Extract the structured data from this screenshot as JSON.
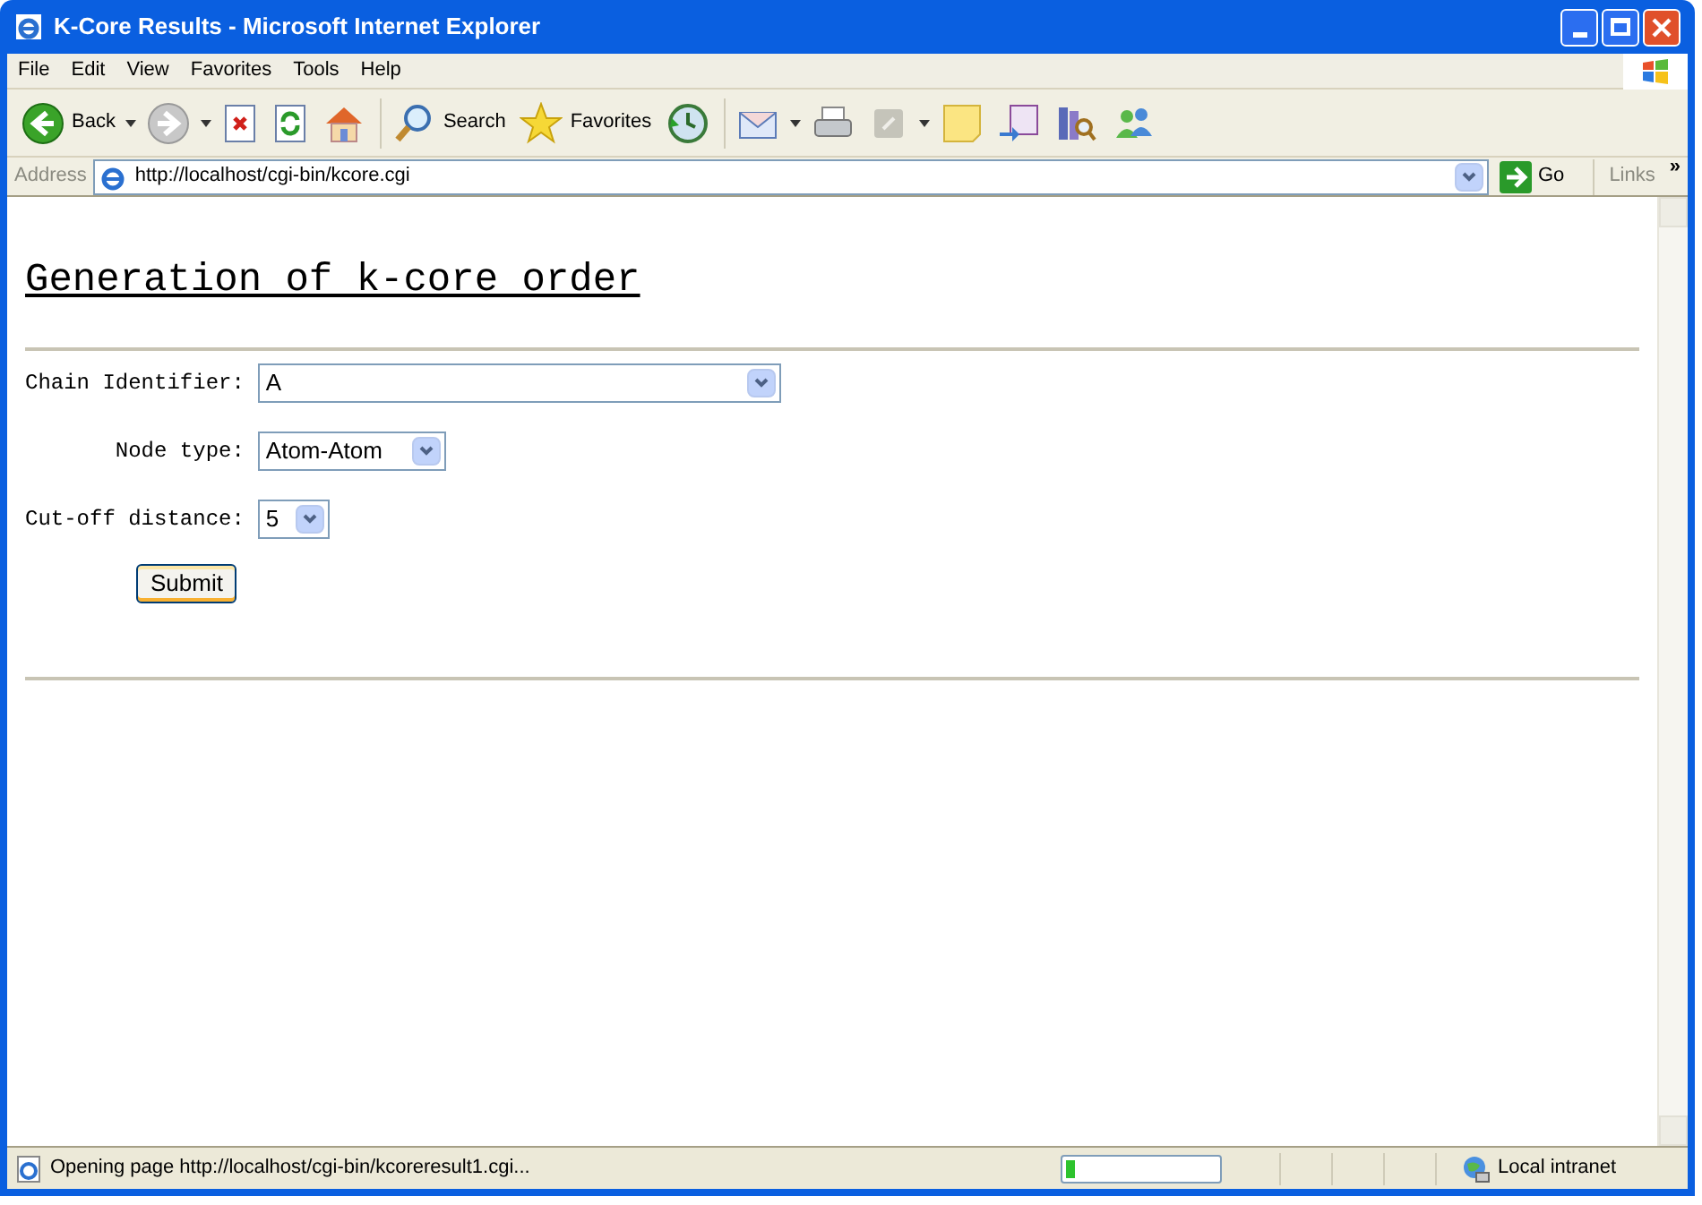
{
  "window": {
    "title": "K-Core Results - Microsoft Internet Explorer"
  },
  "menu": [
    "File",
    "Edit",
    "View",
    "Favorites",
    "Tools",
    "Help"
  ],
  "toolbar": [
    {
      "kind": "back",
      "label": "Back"
    },
    {
      "kind": "forward"
    },
    {
      "kind": "stop"
    },
    {
      "kind": "refresh"
    },
    {
      "kind": "home"
    },
    {
      "kind": "search",
      "label": "Search"
    },
    {
      "kind": "favorites",
      "label": "Favorites"
    },
    {
      "kind": "history"
    },
    {
      "kind": "mail"
    },
    {
      "kind": "print"
    },
    {
      "kind": "edit"
    },
    {
      "kind": "note"
    },
    {
      "kind": "messenger-doc"
    },
    {
      "kind": "research"
    },
    {
      "kind": "messenger"
    }
  ],
  "address_bar": {
    "label": "Address",
    "value": "http://localhost/cgi-bin/kcore.cgi",
    "go": "Go",
    "links": "Links",
    "more": "»"
  },
  "page": {
    "heading": "Generation of k-core order",
    "fields": [
      {
        "label": "Chain Identifier:",
        "value": "A"
      },
      {
        "label": "Node type:",
        "value": "Atom-Atom"
      },
      {
        "label": "Cut-off distance:",
        "value": "5"
      }
    ],
    "submit": "Submit"
  },
  "status_bar": {
    "text": "Opening page http://localhost/cgi-bin/kcoreresult1.cgi...",
    "level": 0.06,
    "zone": "Local intranet"
  }
}
